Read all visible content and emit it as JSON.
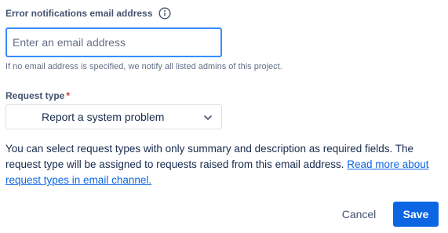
{
  "email_field": {
    "label": "Error notifications email address",
    "info_icon": "info-icon",
    "value": "",
    "placeholder": "Enter an email address",
    "helper": "If no email address is specified, we notify all listed admins of this project."
  },
  "request_type": {
    "label": "Request type",
    "required_marker": "*",
    "selected": "Report a system problem",
    "chevron_icon": "chevron-down-icon"
  },
  "description": {
    "text": "You can select request types with only summary and description as required fields. The request type will be assigned to requests raised from this email address. ",
    "link_text": "Read more about request types in email channel."
  },
  "actions": {
    "cancel_label": "Cancel",
    "save_label": "Save"
  },
  "colors": {
    "primary": "#0c66e4",
    "focus_border": "#388bff",
    "required": "#c9372c",
    "text": "#172b4d",
    "subtle_text": "#626f86"
  }
}
